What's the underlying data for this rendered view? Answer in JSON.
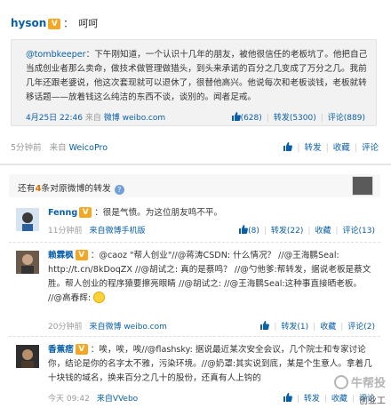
{
  "post": {
    "author": "hyson",
    "text": "呵呵",
    "verified_badge": "V",
    "quote": {
      "mention": "@tombkeeper",
      "text": "：下午刚知道，一个认识十几年的朋友，被他很信任的老板坑了。他把自己当成创业者那么卖命，做技术做管理做猎头，到头来承诺的百分之几变成了万分之几。我前几年还跟老婆说，他这次套现就可以退休了，很替他高兴。他说每次和老板谈钱，老板就转移话题——放着钱这么纯洁的东西不谈，谈別的。闻者足戒。",
      "time": "4月25日 22:46",
      "source_prefix": "来自",
      "source": "微博 weibo.com",
      "like_count": "(628)",
      "forward": "转发(5300)",
      "comment": "评论(889)"
    },
    "time": "5分钟前",
    "source_prefix": "来自",
    "source": "WeicoPro",
    "actions": {
      "forward": "转发",
      "favorite": "收藏",
      "comment": "评论"
    }
  },
  "forwards": {
    "title_prefix": "还有",
    "count": "4",
    "title_suffix": "条对原微博的转发",
    "help": "?",
    "items": [
      {
        "name": "Fenng",
        "text": "：很是气愤。为这位朋友鸣不平。",
        "time": "11分钟前",
        "source": "来自微博手机版",
        "like": "(8)",
        "forward": "转发(22)",
        "favorite": "收藏",
        "comment": "评论(13)"
      },
      {
        "name": "赖霖枫",
        "text": "：@caoz \"帮人创业\"//@蒋涛CSDN: 什么情况？ //@王海鹏Seal: http://t.cn/8kDoqZX //@胡试之: 真的是蔡鸣？ //@勺他爹:帮转发，据说老板是蔡文胜。帮人创业的程序猿要擦亮眼睛 //@胡试之: //@王海鹏Seal:这种事直接晒老板。 //@高春辉:",
        "time": "20分钟前",
        "source": "来自微博 weibo.com",
        "like": "",
        "forward": "转发(1)",
        "favorite": "收藏",
        "comment": "评论(2)"
      },
      {
        "name": "香蕉痞",
        "text": "：唉，唉，唉//@flashsky: 据说最近某次安全会议，几个院士和专家讨论你，结论是你的名字太不雅，污染环境。//@奶罩:其实说到底，某是个生意人。拿着几十块钱的域名，换来百分之几十的股份，还真有人上钩的",
        "time": "今天 09:42",
        "source": "来自VVebo",
        "like": "",
        "forward": "转发",
        "favorite": "收藏",
        "comment": "评论"
      }
    ]
  },
  "watermark": "牛帮投",
  "bottom_cut": "创业工"
}
